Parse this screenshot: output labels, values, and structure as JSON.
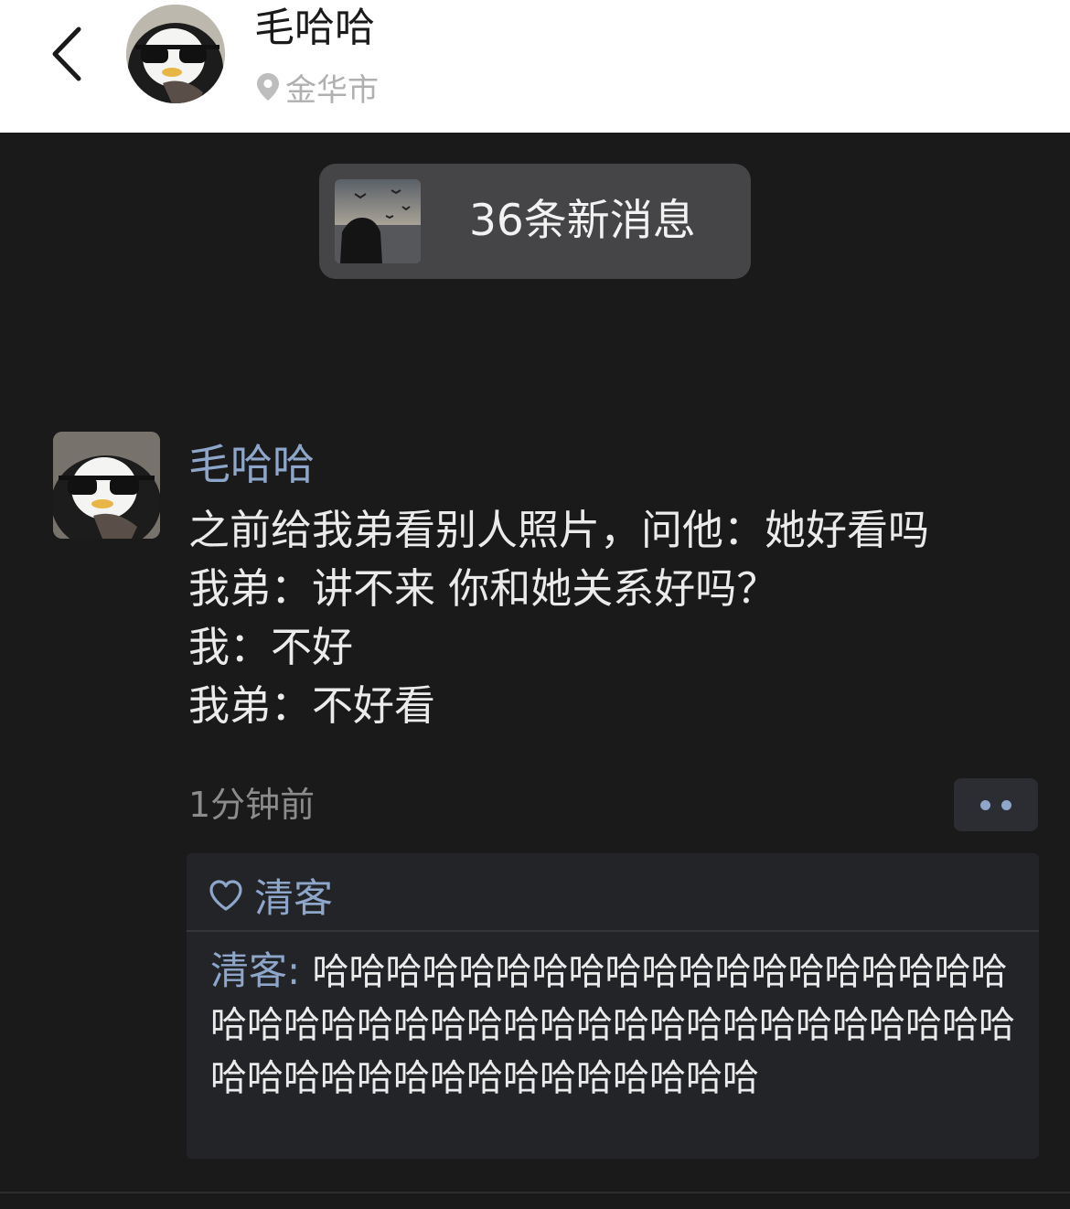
{
  "header": {
    "name": "毛哈哈",
    "location": "金华市"
  },
  "new_messages": {
    "label": "36条新消息"
  },
  "post": {
    "author": "毛哈哈",
    "lines": [
      "之前给我弟看别人照片，问他：她好看吗",
      "我弟：讲不来 你和她关系好吗？",
      "我：不好",
      "我弟：不好看"
    ],
    "time": "1分钟前"
  },
  "likes": {
    "names": "清客"
  },
  "comments": [
    {
      "author": "清客",
      "separator": ": ",
      "text": "哈哈哈哈哈哈哈哈哈哈哈哈哈哈哈哈哈哈哈哈哈哈哈哈哈哈哈哈哈哈哈哈哈哈哈哈哈哈哈哈哈哈哈哈哈哈哈哈哈哈哈哈哈哈哈哈"
    }
  ],
  "colors": {
    "background": "#1a1a1b",
    "link_blue": "#8ea6c9",
    "text": "#ebebeb",
    "muted": "#8c8c8c"
  },
  "icons": {
    "back": "chevron-left-icon",
    "location": "location-pin-icon",
    "heart": "heart-outline-icon",
    "more": "more-dots-icon"
  }
}
